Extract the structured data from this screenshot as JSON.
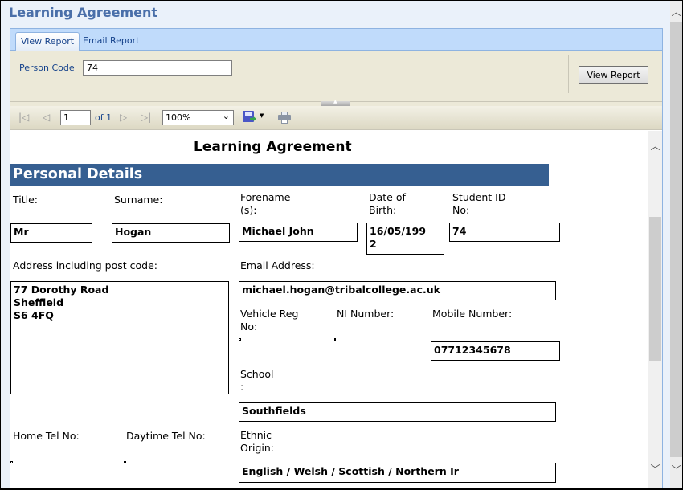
{
  "app": {
    "title": "Learning Agreement"
  },
  "tabs": [
    {
      "label": "View Report",
      "active": true
    },
    {
      "label": "Email Report",
      "active": false
    }
  ],
  "parameters": {
    "person_code_label": "Person Code",
    "person_code_value": "74",
    "view_report_button": "View Report"
  },
  "toolbar": {
    "first_page_icon": "first-page-icon",
    "prev_page_icon": "previous-page-icon",
    "current_page": "1",
    "page_of": "of 1",
    "next_page_icon": "next-page-icon",
    "last_page_icon": "last-page-icon",
    "zoom_value": "100%",
    "export_icon": "save-export-icon",
    "print_icon": "print-icon",
    "glyphs": {
      "first": "|◁",
      "prev": "◁",
      "next": "▷",
      "last": "▷|",
      "dropdown": "⌄",
      "small_dropdown": "▼",
      "collapse": "▲",
      "scroll_up": "︿",
      "scroll_down": "﹀"
    }
  },
  "report": {
    "title": "Learning Agreement",
    "section": "Personal Details",
    "fields": {
      "title_label": "Title:",
      "title_value": "Mr",
      "surname_label": "Surname:",
      "surname_value": "Hogan",
      "forename_label": "Forename\n(s):",
      "forename_value": "Michael John",
      "dob_label": "Date of\nBirth:",
      "dob_value": "16/05/199\n2",
      "student_id_label": "Student ID\nNo:",
      "student_id_value": "74",
      "address_label": "Address including post code:",
      "address_value": "77 Dorothy Road\nSheffield\nS6 4FQ",
      "email_label": "Email Address:",
      "email_value": "michael.hogan@tribalcollege.ac.uk",
      "vehicle_label": "Vehicle Reg\nNo:",
      "vehicle_value": "",
      "ni_label": "NI Number:",
      "ni_value": "",
      "mobile_label": "Mobile Number:",
      "mobile_value": "07712345678",
      "school_label": "School\n:",
      "school_value": "Southfields",
      "home_tel_label": "Home Tel No:",
      "home_tel_value": "",
      "daytime_tel_label": "Daytime Tel No:",
      "daytime_tel_value": "",
      "ethnic_label": "Ethnic\nOrigin:",
      "ethnic_value": "English / Welsh / Scottish / Northern Ir"
    }
  },
  "colors": {
    "title_blue": "#4a6fa9",
    "section_bar": "#365f91",
    "tab_strip": "#c0dbfb",
    "param_bg": "#ece9d8",
    "link_blue": "#15428b"
  }
}
